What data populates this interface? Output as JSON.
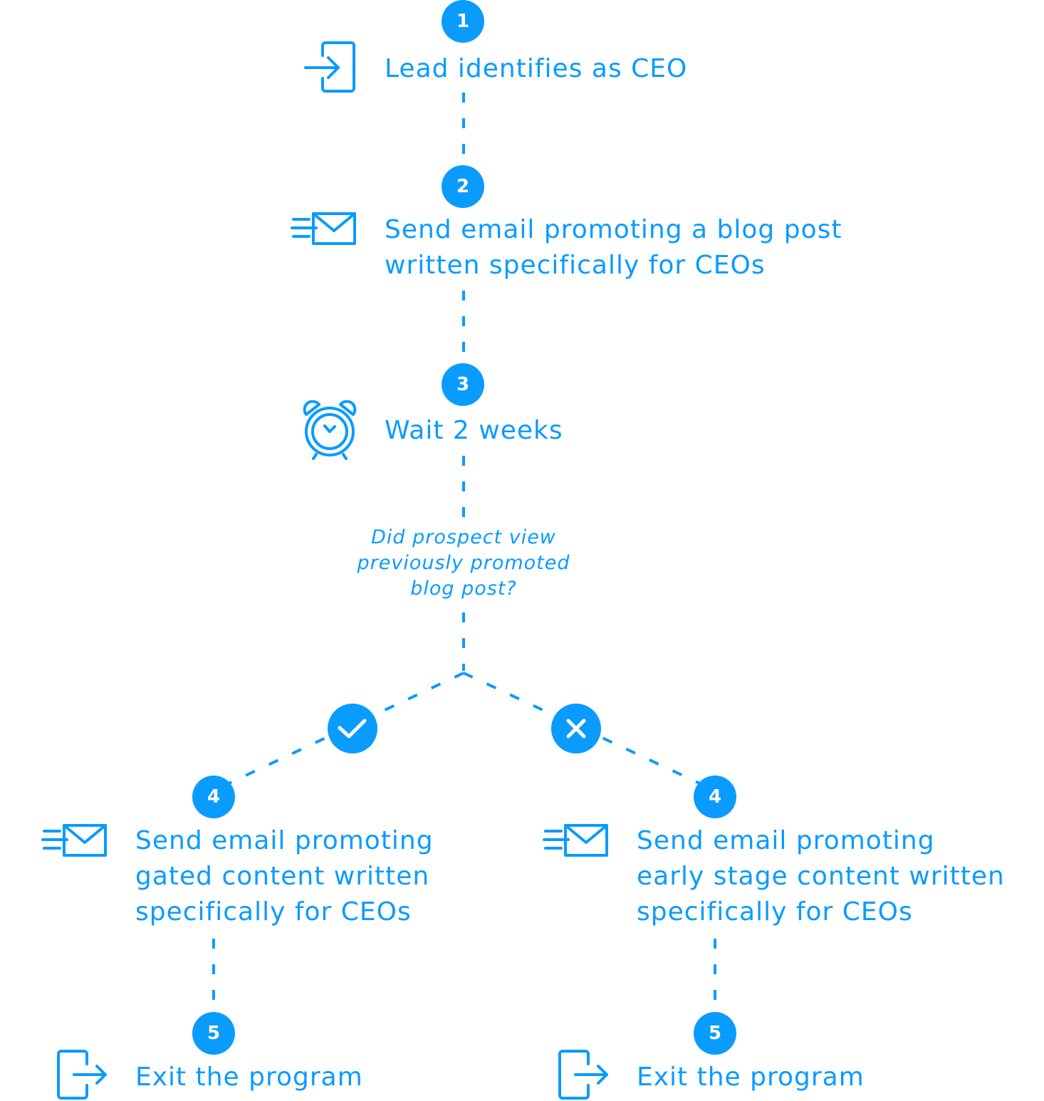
{
  "colors": {
    "accent": "#0a9bff",
    "background": "#ffffff"
  },
  "steps": {
    "s1": {
      "number": "1",
      "icon": "enter-icon",
      "text": "Lead identifies as CEO"
    },
    "s2": {
      "number": "2",
      "icon": "send-email-icon",
      "text": "Send email promoting a blog post\nwritten specifically for CEOs"
    },
    "s3": {
      "number": "3",
      "icon": "alarm-clock-icon",
      "text": "Wait 2 weeks"
    },
    "decision": {
      "question": "Did prospect view\npreviously promoted\nblog post?",
      "yes_icon": "checkmark-icon",
      "no_icon": "close-icon"
    },
    "s4_yes": {
      "number": "4",
      "icon": "send-email-icon",
      "text": "Send email promoting\ngated content written\nspecifically for CEOs"
    },
    "s4_no": {
      "number": "4",
      "icon": "send-email-icon",
      "text": "Send email promoting\nearly stage content written\nspecifically for CEOs"
    },
    "s5_yes": {
      "number": "5",
      "icon": "exit-icon",
      "text": "Exit the program"
    },
    "s5_no": {
      "number": "5",
      "icon": "exit-icon",
      "text": "Exit the program"
    }
  }
}
